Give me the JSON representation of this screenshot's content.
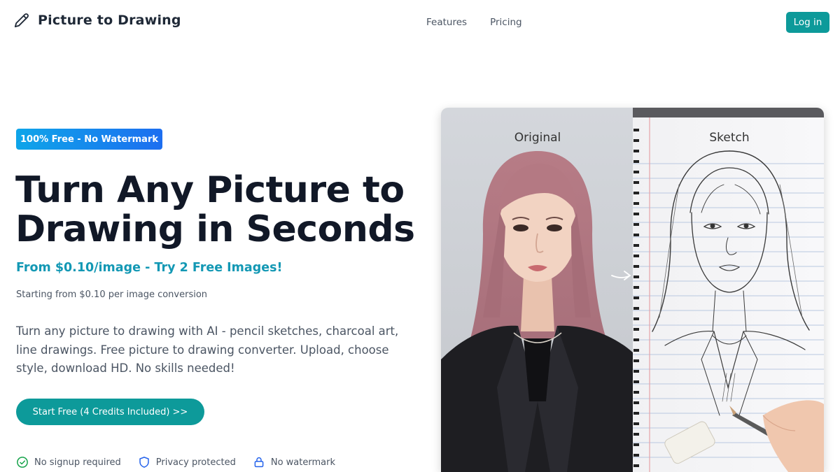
{
  "header": {
    "brand_name": "Picture to Drawing",
    "brand_icon": "pencil-icon",
    "nav": [
      {
        "label": "Features"
      },
      {
        "label": "Pricing"
      }
    ],
    "login_label": "Log in"
  },
  "hero": {
    "badge": "100% Free - No Watermark",
    "title": "Turn Any Picture to Drawing in Seconds",
    "price_line": "From $0.10/image - Try 2 Free Images!",
    "price_sub": "Starting from $0.10 per image conversion",
    "description": "Turn any picture to drawing with AI - pencil sketches, charcoal art, line drawings. Free picture to drawing converter. Upload, choose style, download HD. No skills needed!",
    "cta_label": "Start Free (4 Credits Included) >>",
    "features": [
      {
        "icon": "check-circle-icon",
        "label": "No signup required"
      },
      {
        "icon": "shield-icon",
        "label": "Privacy protected"
      },
      {
        "icon": "lock-icon",
        "label": "No watermark"
      }
    ],
    "image": {
      "left_label": "Original",
      "right_label": "Sketch"
    }
  },
  "colors": {
    "accent": "#0d9a9a",
    "price": "#1398b4",
    "badge_start": "#0ea5e9",
    "badge_end": "#1d6ef0"
  }
}
